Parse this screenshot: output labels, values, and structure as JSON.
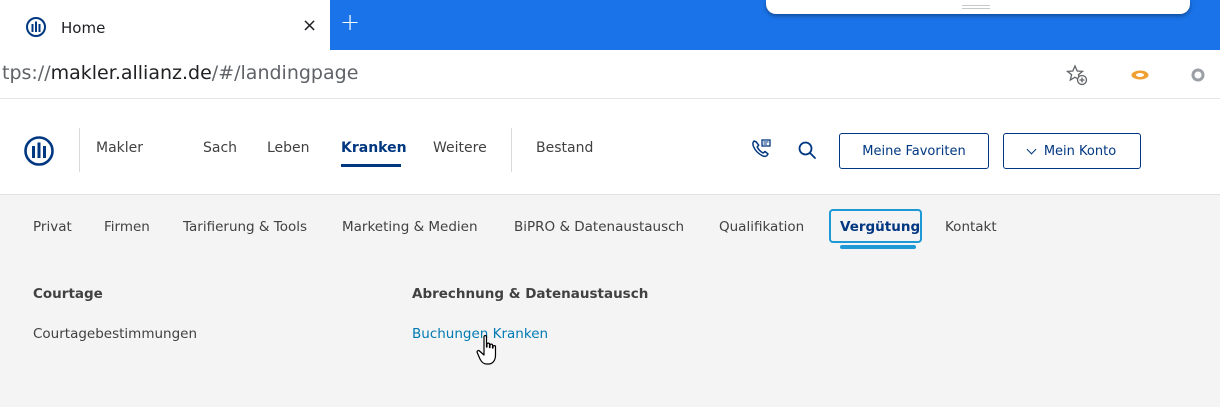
{
  "browser": {
    "tab_title": "Home",
    "tab_close": "×",
    "new_tab": "+",
    "url_prefix": "tps://",
    "url_host": "makler.allianz.de",
    "url_path": "/#/landingpage"
  },
  "header": {
    "nav": [
      {
        "label": "Makler"
      },
      {
        "label": "Sach"
      },
      {
        "label": "Leben"
      },
      {
        "label": "Kranken"
      },
      {
        "label": "Weitere"
      },
      {
        "label": "Bestand"
      }
    ],
    "favorites_label": "Meine Favoriten",
    "account_label": "Mein Konto"
  },
  "subnav": {
    "items": [
      {
        "label": "Privat"
      },
      {
        "label": "Firmen"
      },
      {
        "label": "Tarifierung & Tools"
      },
      {
        "label": "Marketing & Medien"
      },
      {
        "label": "BiPRO & Datenaustausch"
      },
      {
        "label": "Qualifikation"
      },
      {
        "label": "Vergütung"
      },
      {
        "label": "Kontakt"
      }
    ]
  },
  "menu": {
    "columns": [
      {
        "title": "Courtage",
        "links": [
          "Courtagebestimmungen"
        ]
      },
      {
        "title": "Abrechnung & Datenaustausch",
        "links": [
          "Buchungen Kranken"
        ]
      }
    ]
  },
  "colors": {
    "brand": "#003781",
    "accent": "#1d9ad6",
    "chrome_blue": "#1a73e8",
    "link": "#007ab3"
  },
  "icons": [
    "allianz-logo-icon",
    "close-icon",
    "plus-icon",
    "bookmark-star-icon",
    "extension-icon",
    "phone-icon",
    "search-icon",
    "chevron-down-icon",
    "hand-cursor-icon"
  ]
}
